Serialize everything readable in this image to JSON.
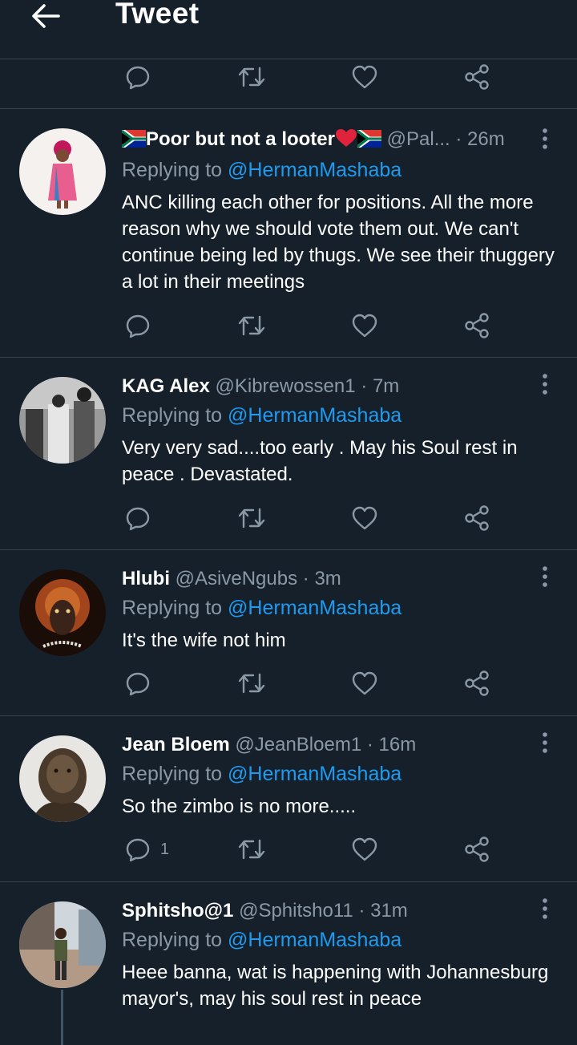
{
  "header": {
    "title": "Tweet"
  },
  "replying_label": "Replying to",
  "tweets": [
    {
      "name": "Poor but not a looter",
      "handle": "@Pal...",
      "time": "· 26m",
      "reply_to": "@HermanMashaba",
      "text": "ANC killing each other for positions. All the more reason why we should vote them out. We can't continue being led by thugs. We see their thuggery a lot in their meetings",
      "reply_count": ""
    },
    {
      "name": "KAG Alex",
      "handle": "@Kibrewossen1",
      "time": "· 7m",
      "reply_to": "@HermanMashaba",
      "text": "Very very sad....too early . May his Soul rest in peace . Devastated.",
      "reply_count": ""
    },
    {
      "name": "Hlubi",
      "handle": "@AsiveNgubs",
      "time": "· 3m",
      "reply_to": "@HermanMashaba",
      "text": "It's the wife not him",
      "reply_count": ""
    },
    {
      "name": "Jean Bloem",
      "handle": "@JeanBloem1",
      "time": "· 16m",
      "reply_to": "@HermanMashaba",
      "text": "So the zimbo is no more.....",
      "reply_count": "1"
    },
    {
      "name": "Sphitsho@1",
      "handle": "@Sphitsho11",
      "time": "· 31m",
      "reply_to": "@HermanMashaba",
      "text": "Heee banna, wat is happening with Johannesburg mayor's, may his soul rest in peace",
      "reply_count": ""
    }
  ],
  "icons": {
    "back": "arrow-left-icon",
    "reply": "reply-icon",
    "retweet": "retweet-icon",
    "like": "heart-icon",
    "share": "share-icon",
    "more": "more-vertical-icon"
  },
  "colors": {
    "background": "#15202b",
    "divider": "#38444d",
    "accent": "#1d9bf0",
    "muted": "#8b98a5",
    "icon": "#8b98a5"
  }
}
